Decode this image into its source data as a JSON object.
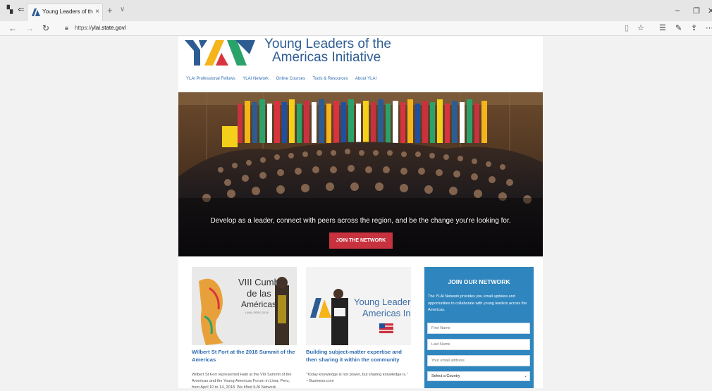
{
  "browser": {
    "tab_title": "Young Leaders of the Ar",
    "tab_close": "×",
    "new_tab": "+",
    "tab_dropdown": "∨",
    "url_prefix": "https://",
    "url_domain": "ylai.state.gov/",
    "icons": [
      "tab-overview-icon",
      "set-aside-tabs-icon",
      "back-icon",
      "forward-icon",
      "refresh-icon",
      "lock-icon",
      "reading-view-icon",
      "favorite-icon",
      "favorites-list-icon",
      "notes-icon",
      "share-icon",
      "more-icon",
      "minimize-icon",
      "restore-icon"
    ]
  },
  "site": {
    "title_line1": "Young Leaders of the",
    "title_line2": "Americas Initiative",
    "nav": [
      "YLAI Professional Fellows",
      "YLAI Network",
      "Online Courses",
      "Tools & Resources",
      "About YLAI"
    ],
    "hero_text": "Develop as a leader, connect with peers across the region, and be the change you're looking for.",
    "hero_button": "JOIN THE NETWORK"
  },
  "cards": [
    {
      "title": "Wilbert St Fort at the 2018 Summit of the Americas",
      "body": "Wilbert St Fort represented Haiti at the VIII Summit of the Americas and the Young Americas Forum in Lima, Peru, from April 10 to 14, 2018. We lifted ILAI Network",
      "image_text_1": "VIII Cumbre",
      "image_text_2": "de las",
      "image_text_3": "Américas",
      "image_text_4": "LIMA, PERÚ 2018"
    },
    {
      "title": "Building subject-matter expertise and then sharing it within the community",
      "body": "“Today knowledge is not power, but sharing knowledge is.” – Business.com",
      "image_text_1": "Young Leaders",
      "image_text_2": "Americas In"
    }
  ],
  "join": {
    "heading": "JOIN OUR NETWORK",
    "text": "The YLAI Network provides you email updates and opportunities to collaborate with young leaders across the Americas.",
    "first_name_placeholder": "First Name",
    "last_name_placeholder": "Last Name",
    "email_placeholder": "Your email address",
    "country_select": "Select a Country"
  },
  "colors": {
    "brand_blue": "#2d5c93",
    "link_blue": "#2d6bb0",
    "join_blue": "#2f86bf",
    "cta_red": "#c8323f",
    "logo_yellow": "#f4b41a",
    "logo_green": "#2aa36b",
    "logo_red": "#d9333f"
  }
}
